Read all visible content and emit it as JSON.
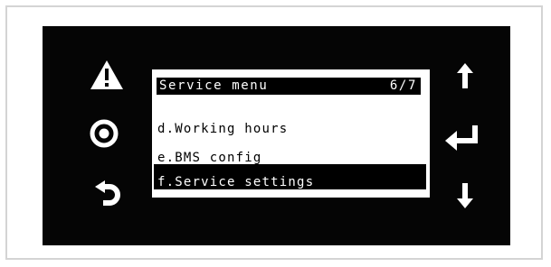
{
  "screen": {
    "title": "Service menu",
    "page_indicator": "6/7",
    "items": [
      {
        "label": "d.Working hours",
        "selected": false
      },
      {
        "label": "e.BMS config",
        "selected": false
      },
      {
        "label": "f.Service settings",
        "selected": true
      }
    ]
  },
  "icons": {
    "left": [
      "warning-icon",
      "target-circle-icon",
      "back-arrow-icon"
    ],
    "right": [
      "arrow-up-icon",
      "enter-icon",
      "arrow-down-icon"
    ]
  },
  "colors": {
    "panel": "#050505",
    "screen": "#ffffff",
    "highlight": "#000000",
    "frame_border": "#d4d4d4"
  }
}
